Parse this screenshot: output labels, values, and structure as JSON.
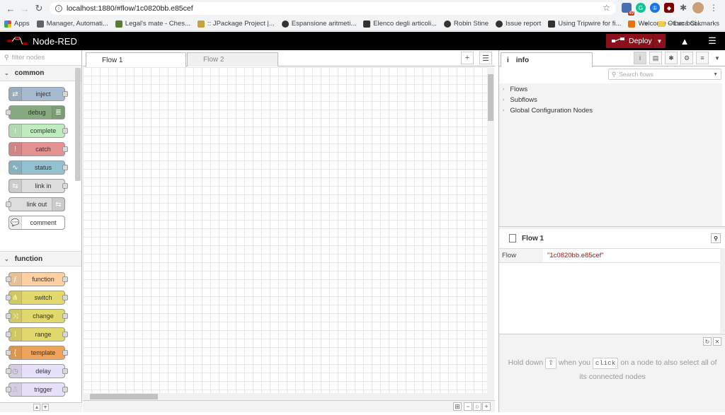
{
  "browser": {
    "url": "localhost:1880/#flow/1c0820bb.e85cef",
    "badge_count": "49",
    "bookmarks": [
      {
        "label": "Apps",
        "color": "#4285f4"
      },
      {
        "label": "Manager, Automati...",
        "color": "#5f6368"
      },
      {
        "label": "Legal's mate - Ches...",
        "color": "#5b7d32"
      },
      {
        "label": ":: JPackage Project |...",
        "color": "#caa03a"
      },
      {
        "label": "Espansione aritmeti...",
        "color": "#333333"
      },
      {
        "label": "Elenco degli articoli...",
        "color": "#333333"
      },
      {
        "label": "Robin Stine",
        "color": "#333333"
      },
      {
        "label": "Issue report",
        "color": "#333333"
      },
      {
        "label": "Using Tripwire for fi...",
        "color": "#333333"
      },
      {
        "label": "Welcome – Luca Ci...",
        "color": "#e8710a"
      }
    ],
    "more": "»",
    "other_bookmarks": "Other bookmarks"
  },
  "header": {
    "title": "Node-RED",
    "deploy_label": "Deploy"
  },
  "palette": {
    "filter_placeholder": "filter nodes",
    "categories": [
      {
        "name": "common",
        "nodes": [
          {
            "label": "inject",
            "color": "#a6bbcf"
          },
          {
            "label": "debug",
            "color": "#87a980"
          },
          {
            "label": "complete",
            "color": "#c0edc0"
          },
          {
            "label": "catch",
            "color": "#e49191"
          },
          {
            "label": "status",
            "color": "#94c1d0"
          },
          {
            "label": "link in",
            "color": "#dddddd"
          },
          {
            "label": "link out",
            "color": "#dddddd"
          },
          {
            "label": "comment",
            "color": "#ffffff"
          }
        ]
      },
      {
        "name": "function",
        "nodes": [
          {
            "label": "function",
            "color": "#fdd0a2"
          },
          {
            "label": "switch",
            "color": "#e2d96e"
          },
          {
            "label": "change",
            "color": "#e2d96e"
          },
          {
            "label": "range",
            "color": "#e2d96e"
          },
          {
            "label": "template",
            "color": "#f0a35a"
          },
          {
            "label": "delay",
            "color": "#e6e0f8"
          },
          {
            "label": "trigger",
            "color": "#e6e0f8"
          }
        ]
      }
    ]
  },
  "workspace": {
    "tabs": [
      {
        "label": "Flow 1",
        "active": true
      },
      {
        "label": "Flow 2",
        "active": false
      }
    ]
  },
  "sidebar": {
    "tab_label": "info",
    "search_placeholder": "Search flows",
    "tree": [
      "Flows",
      "Subflows",
      "Global Configuration Nodes"
    ],
    "flow_title": "Flow 1",
    "properties": [
      {
        "key": "Flow",
        "value": "\"1c0820bb.e85cef\""
      }
    ],
    "tip": {
      "part1": "Hold down",
      "key1": "⇧",
      "part2": "when you",
      "key2": "click",
      "part3": "on a node to also select all of its connected nodes"
    }
  }
}
